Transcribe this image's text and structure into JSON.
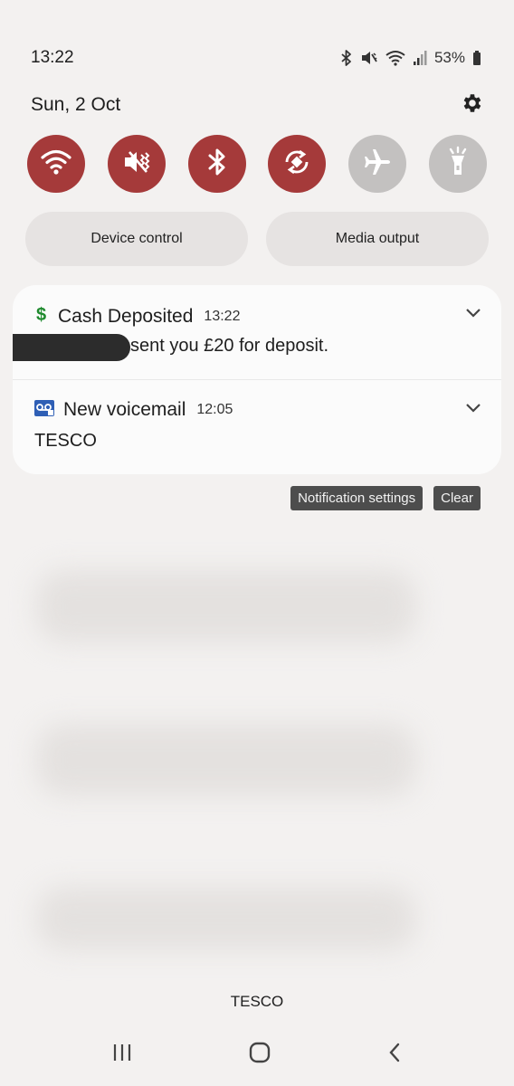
{
  "status_bar": {
    "time": "13:22",
    "battery": "53%",
    "icons": [
      "bluetooth-icon",
      "mute-icon",
      "wifi-icon",
      "signal-icon",
      "battery-icon"
    ]
  },
  "header": {
    "date": "Sun, 2 Oct",
    "settings_icon": "gear-icon"
  },
  "quick_settings": [
    {
      "name": "wifi",
      "icon": "wifi-icon",
      "active": true
    },
    {
      "name": "mute",
      "icon": "mute-icon",
      "active": true
    },
    {
      "name": "bluetooth",
      "icon": "bluetooth-icon",
      "active": true
    },
    {
      "name": "auto-rotate",
      "icon": "rotate-icon",
      "active": true
    },
    {
      "name": "airplane",
      "icon": "airplane-icon",
      "active": false
    },
    {
      "name": "flashlight",
      "icon": "flashlight-icon",
      "active": false
    }
  ],
  "pills": {
    "device_control": "Device control",
    "media_output": "Media output"
  },
  "notifications": [
    {
      "icon": "dollar-icon",
      "title": "Cash Deposited",
      "time": "13:22",
      "body": "sent you £20 for deposit."
    },
    {
      "icon": "voicemail-icon",
      "title": "New voicemail",
      "time": "12:05",
      "body": "TESCO"
    }
  ],
  "actions": {
    "notification_settings": "Notification settings",
    "clear": "Clear"
  },
  "footer": {
    "label": "TESCO"
  },
  "colors": {
    "accent_active": "#a53a3a",
    "inactive": "#c3c1c0",
    "dollar_green": "#1f8a2e",
    "voicemail_blue": "#2f5fb5"
  }
}
